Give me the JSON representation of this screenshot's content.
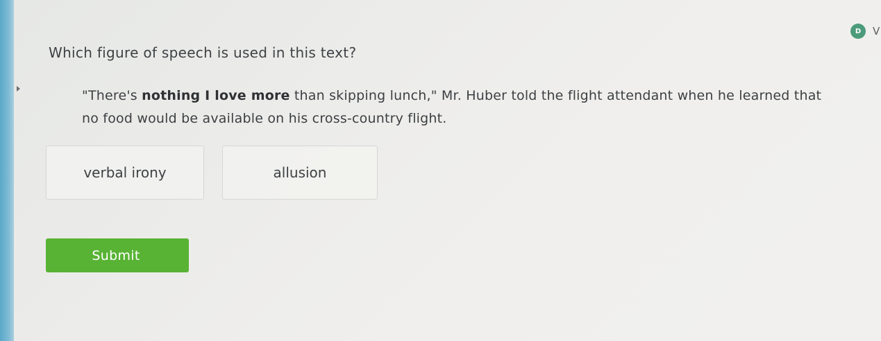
{
  "header": {
    "badge_icon": "d-badge-icon",
    "badge_text": "D",
    "cutoff_text": "V"
  },
  "question": {
    "prompt": "Which figure of speech is used in this text?",
    "passage": {
      "before_bold": "\"There's ",
      "bold": "nothing I love more",
      "after_bold": " than skipping lunch,\" Mr. Huber told the flight attendant when he learned that no food would be available on his cross-country flight."
    }
  },
  "choices": [
    {
      "label": "verbal irony"
    },
    {
      "label": "allusion"
    }
  ],
  "actions": {
    "submit_label": "Submit"
  },
  "colors": {
    "accent_green": "#58b334",
    "sidebar_blue": "#5aa8c9",
    "badge_green": "#4c9b7a"
  }
}
